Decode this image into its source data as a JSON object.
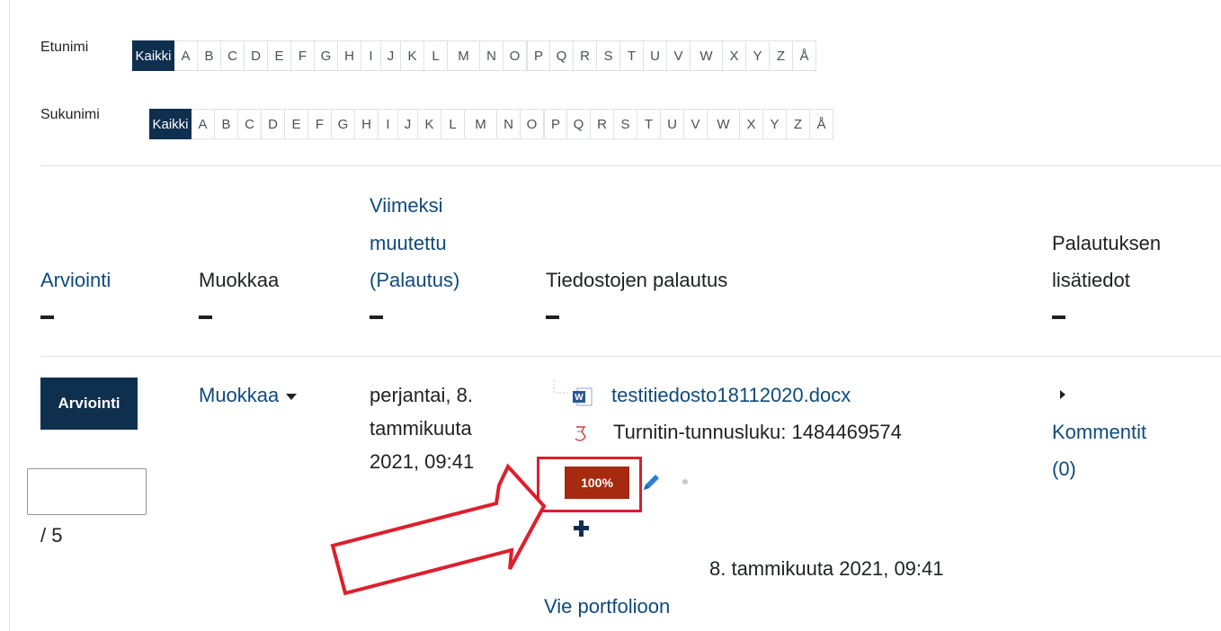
{
  "filters": {
    "first_name": {
      "label": "Etunimi",
      "all": "Kaikki",
      "letters": [
        "A",
        "B",
        "C",
        "D",
        "E",
        "F",
        "G",
        "H",
        "I",
        "J",
        "K",
        "L",
        "M",
        "N",
        "O",
        "P",
        "Q",
        "R",
        "S",
        "T",
        "U",
        "V",
        "W",
        "X",
        "Y",
        "Z",
        "Å"
      ]
    },
    "last_name": {
      "label": "Sukunimi",
      "all": "Kaikki",
      "letters": [
        "A",
        "B",
        "C",
        "D",
        "E",
        "F",
        "G",
        "H",
        "I",
        "J",
        "K",
        "L",
        "M",
        "N",
        "O",
        "P",
        "Q",
        "R",
        "S",
        "T",
        "U",
        "V",
        "W",
        "X",
        "Y",
        "Z",
        "Å"
      ]
    }
  },
  "columns": {
    "grading": "Arviointi",
    "edit": "Muokkaa",
    "modified_l1": "Viimeksi",
    "modified_l2": "muutettu",
    "modified_l3": "(Palautus)",
    "files": "Tiedostojen palautus",
    "feedback_l1": "Palautuksen",
    "feedback_l2": "lisätiedot"
  },
  "row": {
    "grade_button": "Arviointi",
    "grade_value": "",
    "grade_max": "/ 5",
    "edit_menu": "Muokkaa",
    "modified_l1": "perjantai, 8.",
    "modified_l2": "tammikuuta",
    "modified_l3": "2021, 09:41",
    "file_name": "testitiedosto18112020.docx",
    "turnitin_label": "Turnitin-tunnusluku: 1484469574",
    "similarity": "100%",
    "file_date": "8. tammikuuta 2021, 09:41",
    "portfolio_link": "Vie portfolioon",
    "comments_l1": "Kommentit",
    "comments_l2": "(0)"
  },
  "colors": {
    "accent": "#0f2f4f",
    "link": "#0f4a7c",
    "badge": "#a52a0f",
    "highlight": "#dd1f2c"
  }
}
